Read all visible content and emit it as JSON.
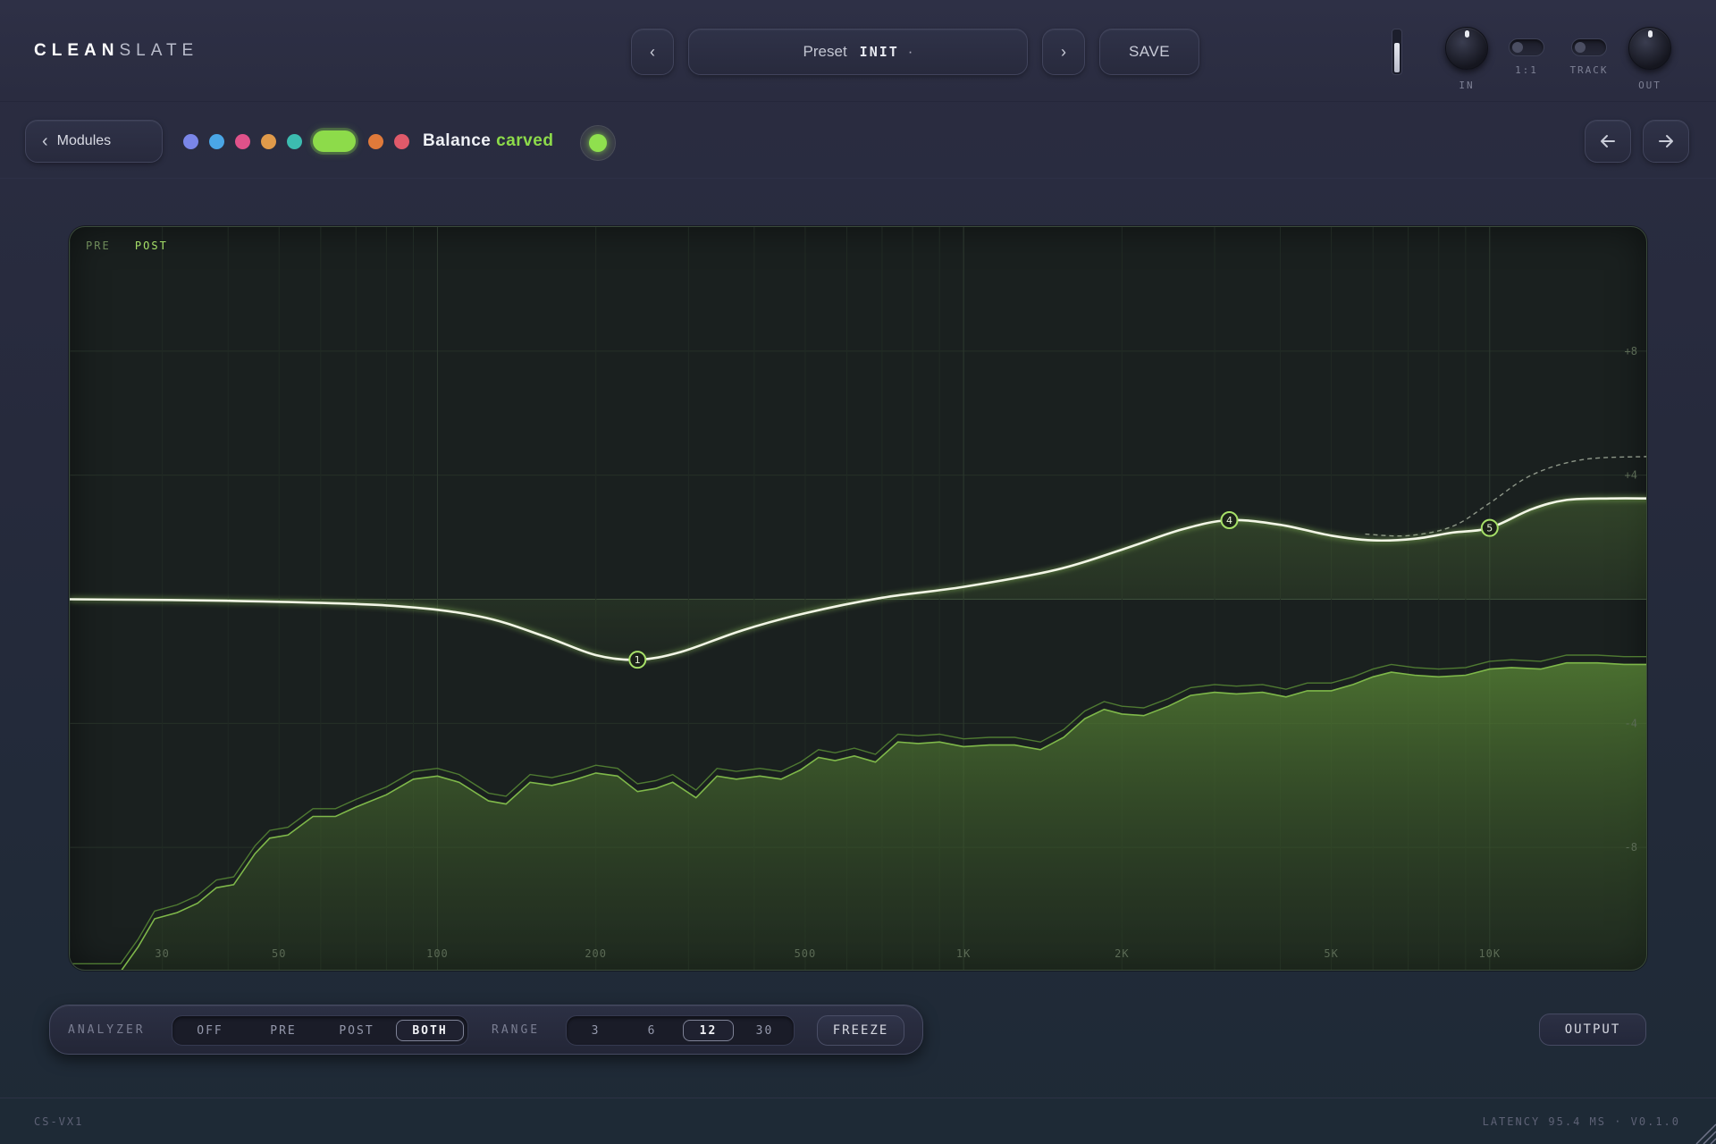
{
  "app": {
    "logo_bold": "CLEAN",
    "logo_light": "SLATE"
  },
  "header": {
    "prev_label": "‹",
    "next_label": "›",
    "preset_label": "Preset",
    "preset_value": "INIT",
    "preset_modified_marker": "·",
    "save_label": "SAVE",
    "input_meter_level": 0.72,
    "controls": {
      "in_label": "IN",
      "one_to_one_label": "1:1",
      "track_label": "TRACK",
      "out_label": "OUT",
      "one_to_one_on": false,
      "track_on": false
    }
  },
  "module_bar": {
    "modules_label": "Modules",
    "band_colors": [
      "#7a86e8",
      "#4aa6e6",
      "#e0528a",
      "#e09a4a",
      "#3cbcb0",
      "#8ddb4a",
      "#e07a3a",
      "#e05a6a"
    ],
    "selected_band_index": 5,
    "band_title_main": "Balance",
    "band_title_accent": "carved",
    "band_enabled": true,
    "back_icon": "arrow-left-icon",
    "forward_icon": "arrow-right-icon"
  },
  "eq": {
    "legend_pre": "PRE",
    "legend_post": "POST",
    "freq_labels": [
      {
        "freq": 30,
        "label": "30"
      },
      {
        "freq": 50,
        "label": "50"
      },
      {
        "freq": 100,
        "label": "100"
      },
      {
        "freq": 200,
        "label": "200"
      },
      {
        "freq": 500,
        "label": "500"
      },
      {
        "freq": 1000,
        "label": "1K"
      },
      {
        "freq": 2000,
        "label": "2K"
      },
      {
        "freq": 5000,
        "label": "5K"
      },
      {
        "freq": 10000,
        "label": "10K"
      }
    ],
    "db_labels": [
      {
        "db": 8,
        "label": "+8"
      },
      {
        "db": 4,
        "label": "+4"
      },
      {
        "db": -4,
        "label": "-4"
      },
      {
        "db": -8,
        "label": "-8"
      }
    ],
    "db_range": [
      -12,
      12
    ],
    "freq_range": [
      20,
      20000
    ],
    "curve": [
      [
        20,
        0.0
      ],
      [
        40,
        -0.05
      ],
      [
        80,
        -0.2
      ],
      [
        120,
        -0.55
      ],
      [
        160,
        -1.2
      ],
      [
        200,
        -1.8
      ],
      [
        240,
        -1.95
      ],
      [
        290,
        -1.7
      ],
      [
        380,
        -1.0
      ],
      [
        500,
        -0.45
      ],
      [
        700,
        0.05
      ],
      [
        1000,
        0.4
      ],
      [
        1500,
        0.95
      ],
      [
        2000,
        1.6
      ],
      [
        2600,
        2.25
      ],
      [
        3200,
        2.55
      ],
      [
        4000,
        2.4
      ],
      [
        5000,
        2.05
      ],
      [
        6000,
        1.9
      ],
      [
        7200,
        1.95
      ],
      [
        8500,
        2.15
      ],
      [
        10000,
        2.3
      ],
      [
        12000,
        2.9
      ],
      [
        14000,
        3.2
      ],
      [
        17000,
        3.25
      ],
      [
        20000,
        3.25
      ]
    ],
    "ghost_curve": [
      [
        5800,
        2.1
      ],
      [
        7000,
        2.05
      ],
      [
        8500,
        2.35
      ],
      [
        10000,
        3.1
      ],
      [
        12000,
        4.0
      ],
      [
        15000,
        4.5
      ],
      [
        20000,
        4.6
      ]
    ],
    "nodes": [
      {
        "label": "1",
        "freq": 240,
        "db": -1.95
      },
      {
        "label": "4",
        "freq": 3200,
        "db": 2.55
      },
      {
        "label": "5",
        "freq": 10000,
        "db": 2.3
      }
    ],
    "spectrum_post": [
      [
        20,
        -12
      ],
      [
        25,
        -12
      ],
      [
        27,
        -11.2
      ],
      [
        29,
        -10.3
      ],
      [
        32,
        -10.1
      ],
      [
        35,
        -9.8
      ],
      [
        38,
        -9.3
      ],
      [
        41,
        -9.2
      ],
      [
        45,
        -8.2
      ],
      [
        48,
        -7.7
      ],
      [
        52,
        -7.6
      ],
      [
        58,
        -7.0
      ],
      [
        64,
        -7.0
      ],
      [
        70,
        -6.7
      ],
      [
        80,
        -6.3
      ],
      [
        90,
        -5.8
      ],
      [
        100,
        -5.7
      ],
      [
        110,
        -5.9
      ],
      [
        125,
        -6.5
      ],
      [
        135,
        -6.6
      ],
      [
        150,
        -5.9
      ],
      [
        165,
        -6.0
      ],
      [
        180,
        -5.85
      ],
      [
        200,
        -5.6
      ],
      [
        220,
        -5.7
      ],
      [
        240,
        -6.2
      ],
      [
        260,
        -6.1
      ],
      [
        280,
        -5.9
      ],
      [
        310,
        -6.4
      ],
      [
        340,
        -5.7
      ],
      [
        370,
        -5.8
      ],
      [
        410,
        -5.7
      ],
      [
        450,
        -5.8
      ],
      [
        490,
        -5.5
      ],
      [
        530,
        -5.1
      ],
      [
        570,
        -5.2
      ],
      [
        620,
        -5.05
      ],
      [
        680,
        -5.25
      ],
      [
        750,
        -4.6
      ],
      [
        820,
        -4.65
      ],
      [
        900,
        -4.6
      ],
      [
        1000,
        -4.75
      ],
      [
        1120,
        -4.7
      ],
      [
        1250,
        -4.7
      ],
      [
        1400,
        -4.85
      ],
      [
        1550,
        -4.45
      ],
      [
        1700,
        -3.85
      ],
      [
        1850,
        -3.55
      ],
      [
        2000,
        -3.7
      ],
      [
        2200,
        -3.75
      ],
      [
        2450,
        -3.45
      ],
      [
        2700,
        -3.1
      ],
      [
        3000,
        -3.0
      ],
      [
        3300,
        -3.05
      ],
      [
        3700,
        -3.0
      ],
      [
        4100,
        -3.15
      ],
      [
        4500,
        -2.95
      ],
      [
        5000,
        -2.95
      ],
      [
        5500,
        -2.75
      ],
      [
        6000,
        -2.5
      ],
      [
        6500,
        -2.35
      ],
      [
        7200,
        -2.45
      ],
      [
        8000,
        -2.5
      ],
      [
        9000,
        -2.45
      ],
      [
        10000,
        -2.25
      ],
      [
        11000,
        -2.2
      ],
      [
        12500,
        -2.25
      ],
      [
        14000,
        -2.05
      ],
      [
        16000,
        -2.05
      ],
      [
        18000,
        -2.1
      ],
      [
        20000,
        -2.1
      ]
    ],
    "spectrum_pre_offset_db": 0.25
  },
  "analyzer": {
    "label": "ANALYZER",
    "modes": [
      "OFF",
      "PRE",
      "POST",
      "BOTH"
    ],
    "active_mode": "BOTH",
    "range_label": "RANGE",
    "ranges": [
      "3",
      "6",
      "12",
      "30"
    ],
    "active_range": "12",
    "freeze_label": "FREEZE",
    "output_label": "OUTPUT"
  },
  "footer": {
    "model": "CS-VX1",
    "latency": "LATENCY 95.4 MS · V0.1.0"
  }
}
